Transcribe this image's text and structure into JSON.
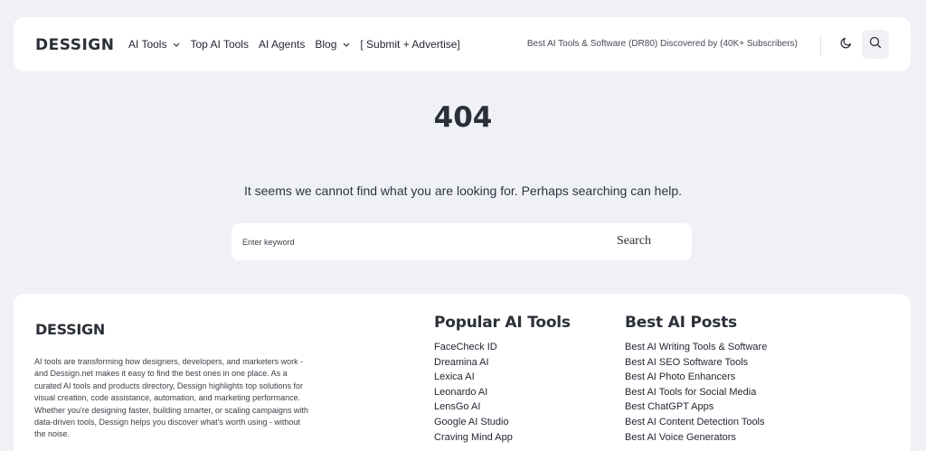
{
  "header": {
    "logo": "DESSIGN",
    "nav": [
      {
        "label": "AI Tools",
        "has_dropdown": true
      },
      {
        "label": "Top AI Tools",
        "has_dropdown": false
      },
      {
        "label": "AI Agents",
        "has_dropdown": false
      },
      {
        "label": "Blog",
        "has_dropdown": true
      },
      {
        "label": "[ Submit + Advertise]",
        "has_dropdown": false
      }
    ],
    "tagline": "Best AI Tools & Software (DR80) Discovered by (40K+ Subscribers)",
    "icons": {
      "theme_toggle": "moon-icon",
      "search": "search-icon"
    }
  },
  "main": {
    "error_code": "404",
    "message": "It seems we cannot find what you are looking for. Perhaps searching can help.",
    "search": {
      "placeholder": "Enter keyword",
      "value": "",
      "button_label": "Search"
    }
  },
  "footer": {
    "logo": "DESSIGN",
    "description": "AI tools are transforming how designers, developers, and marketers work - and Dessign.net makes it easy to find the best ones in one place. As a curated AI tools and products directory, Dessign highlights top solutions for visual creation, code assistance, automation, and marketing performance. Whether you're designing faster, building smarter, or scaling campaigns with data-driven tools, Dessign helps you discover what's worth using - without the noise.",
    "columns": [
      {
        "title": "Popular AI Tools",
        "items": [
          "FaceCheck ID",
          "Dreamina AI",
          "Lexica AI",
          "Leonardo AI",
          "LensGo AI",
          "Google AI Studio",
          "Craving Mind App"
        ]
      },
      {
        "title": "Best AI Posts",
        "items": [
          "Best AI Writing Tools & Software",
          "Best AI SEO Software Tools",
          "Best AI Photo Enhancers",
          "Best AI Tools for Social Media",
          "Best ChatGPT Apps",
          "Best AI Content Detection Tools",
          "Best AI Voice Generators"
        ]
      }
    ]
  },
  "colors": {
    "page_bg": "#eff1f6",
    "card_bg": "#ffffff",
    "text": "#1f2430"
  }
}
